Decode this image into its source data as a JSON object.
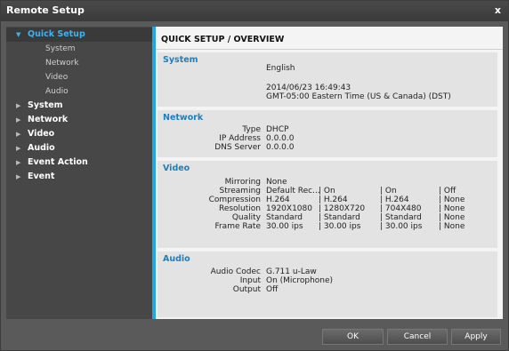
{
  "window": {
    "title": "Remote Setup",
    "close": "x"
  },
  "sidebar": {
    "items": [
      {
        "label": "Quick Setup",
        "selected": true,
        "expanded": true,
        "children": [
          "System",
          "Network",
          "Video",
          "Audio"
        ]
      },
      {
        "label": "System"
      },
      {
        "label": "Network"
      },
      {
        "label": "Video"
      },
      {
        "label": "Audio"
      },
      {
        "label": "Event Action"
      },
      {
        "label": "Event"
      }
    ]
  },
  "content": {
    "title": "QUICK SETUP / OVERVIEW",
    "system": {
      "title": "System",
      "language": "English",
      "datetime": "2014/06/23 16:49:43",
      "timezone": "GMT-05:00 Eastern Time (US & Canada) (DST)"
    },
    "network": {
      "title": "Network",
      "type_label": "Type",
      "type_value": "DHCP",
      "ip_label": "IP Address",
      "ip_value": "0.0.0.0",
      "dns_label": "DNS Server",
      "dns_value": "0.0.0.0"
    },
    "video": {
      "title": "Video",
      "mirroring_label": "Mirroring",
      "mirroring_value": "None",
      "rows": [
        {
          "label": "Streaming",
          "cols": [
            "Default Rec...",
            "| On",
            "| On",
            "| Off"
          ]
        },
        {
          "label": "Compression",
          "cols": [
            "H.264",
            "| H.264",
            "| H.264",
            "| None"
          ]
        },
        {
          "label": "Resolution",
          "cols": [
            "1920X1080",
            "| 1280X720",
            "| 704X480",
            "| None"
          ]
        },
        {
          "label": "Quality",
          "cols": [
            "Standard",
            "| Standard",
            "| Standard",
            "| None"
          ]
        },
        {
          "label": "Frame Rate",
          "cols": [
            "30.00 ips",
            "| 30.00 ips",
            "| 30.00 ips",
            "| None"
          ]
        }
      ]
    },
    "audio": {
      "title": "Audio",
      "codec_label": "Audio Codec",
      "codec_value": "G.711 u-Law",
      "input_label": "Input",
      "input_value": "On (Microphone)",
      "output_label": "Output",
      "output_value": "Off"
    }
  },
  "footer": {
    "ok": "OK",
    "cancel": "Cancel",
    "apply": "Apply"
  },
  "colors": {
    "accent": "#21a6e8",
    "section_title": "#1a7fc3",
    "selected_nav": "#3fb3ef"
  }
}
